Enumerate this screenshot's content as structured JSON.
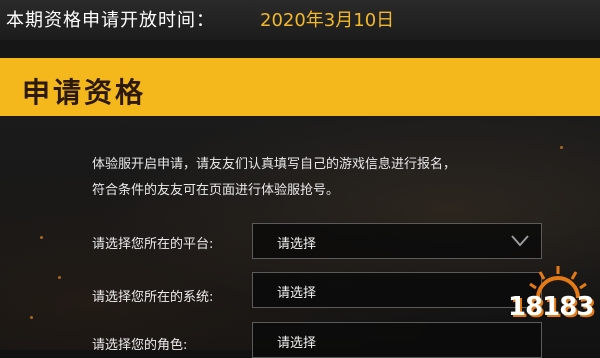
{
  "top": {
    "label": "本期资格申请开放时间：",
    "value": "2020年3月10日"
  },
  "header": {
    "title": "申请资格"
  },
  "intro": {
    "line1": "体验服开启申请，请友友们认真填写自己的游戏信息进行报名，",
    "line2": "符合条件的友友可在页面进行体验服抢号。"
  },
  "form": {
    "fields": [
      {
        "label": "请选择您所在的平台:",
        "value": "请选择"
      },
      {
        "label": "请选择您所在的系统:",
        "value": "请选择"
      },
      {
        "label": "请选择您的角色:",
        "value": "请选择"
      }
    ]
  },
  "watermark": {
    "text": "18183"
  },
  "colors": {
    "accent": "#f5b81c",
    "date": "#f2b829"
  },
  "icons": {
    "dropdown": "chevron-down-icon"
  }
}
